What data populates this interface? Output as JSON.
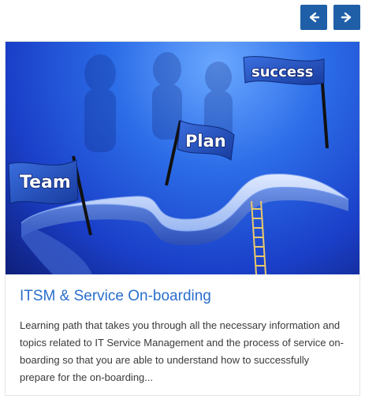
{
  "navigation": {
    "prev_icon": "arrow-left-icon",
    "next_icon": "arrow-right-icon",
    "accent_color": "#1f5fa8"
  },
  "card": {
    "image": {
      "flags": [
        {
          "label": "Team"
        },
        {
          "label": "Plan"
        },
        {
          "label": "success"
        }
      ]
    },
    "title": "ITSM & Service On-boarding",
    "description": "Learning path that takes you through all the necessary information and topics related to IT Service Management and the process of service on-boarding so that you are able to understand how to successfully prepare for the on-boarding..."
  }
}
